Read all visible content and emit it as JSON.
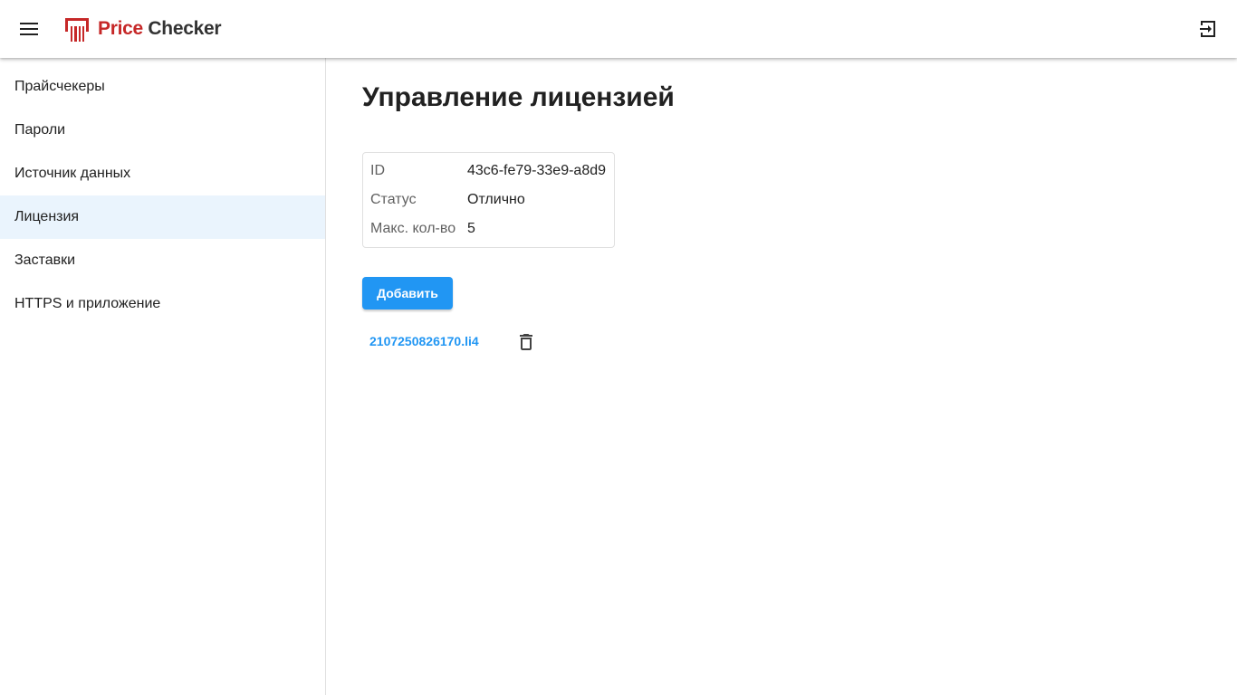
{
  "header": {
    "menu_icon": "hamburger-menu-icon",
    "logo_icon": "barcode-scanner-logo",
    "logo_price": "Price",
    "logo_checker": "Checker",
    "exit_icon": "logout-icon",
    "brand_color": "#c62828"
  },
  "sidebar": {
    "items": [
      {
        "label": "Прайсчекеры",
        "active": false
      },
      {
        "label": "Пароли",
        "active": false
      },
      {
        "label": "Источник данных",
        "active": false
      },
      {
        "label": "Лицензия",
        "active": true
      },
      {
        "label": "Заставки",
        "active": false
      },
      {
        "label": "HTTPS и приложение",
        "active": false
      }
    ],
    "active_bg": "#eaf4fd"
  },
  "main": {
    "title": "Управление лицензией",
    "license": {
      "rows": [
        {
          "label": "ID",
          "value": "43c6-fe79-33e9-a8d9"
        },
        {
          "label": "Статус",
          "value": "Отлично"
        },
        {
          "label": "Макс. кол-во",
          "value": "5"
        }
      ]
    },
    "add_button": "Добавить",
    "files": [
      {
        "name": "2107250826170.li4",
        "delete_icon": "trash-icon"
      }
    ],
    "accent_color": "#2196f3"
  }
}
